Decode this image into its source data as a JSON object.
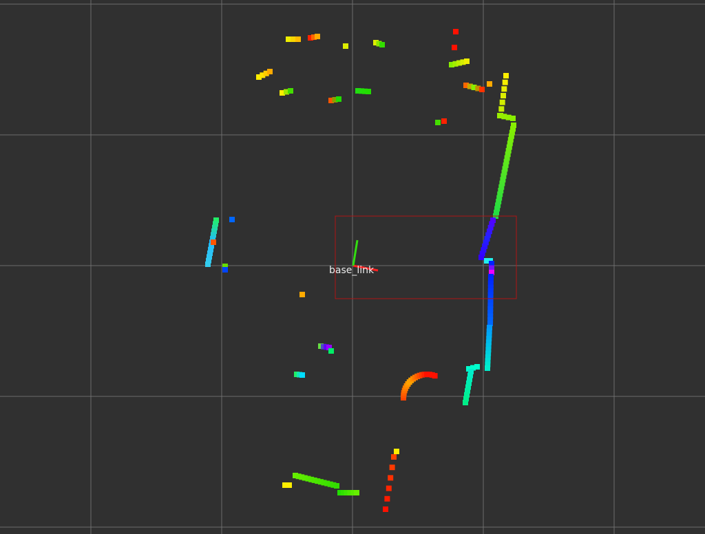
{
  "frame": {
    "label": "base_link"
  },
  "colors": {
    "background": "#303030",
    "grid": "#a0a0a0",
    "bbox": "#b01515",
    "x_axis": "#ff2020",
    "y_axis": "#33dd11"
  },
  "point_cloud": {
    "segments": [
      {
        "from": [
          419,
          57
        ],
        "to": [
          433,
          57
        ],
        "colors": [
          "#eeee00",
          "#ffbb00"
        ],
        "count": 3
      },
      {
        "from": [
          451,
          55
        ],
        "to": [
          461,
          53
        ],
        "colors": [
          "#ff2200",
          "#ffaa00"
        ],
        "count": 3
      },
      {
        "from": [
          502,
          67
        ],
        "to": [
          502,
          67
        ],
        "colors": [
          "#ddee00"
        ],
        "count": 1
      },
      {
        "from": [
          546,
          62
        ],
        "to": [
          555,
          65
        ],
        "colors": [
          "#ddee00",
          "#33dd00"
        ],
        "count": 3
      },
      {
        "from": [
          376,
          112
        ],
        "to": [
          392,
          104
        ],
        "colors": [
          "#ffee00",
          "#ffdd00",
          "#ffaa00"
        ],
        "count": 4
      },
      {
        "from": [
          410,
          135
        ],
        "to": [
          422,
          132
        ],
        "colors": [
          "#ffee00",
          "#44dd00"
        ],
        "count": 3
      },
      {
        "from": [
          481,
          146
        ],
        "to": [
          492,
          144
        ],
        "colors": [
          "#ff5500",
          "#22dd00"
        ],
        "count": 3
      },
      {
        "from": [
          520,
          132
        ],
        "to": [
          535,
          133
        ],
        "colors": [
          "#22dd11",
          "#22dd00"
        ],
        "count": 4
      },
      {
        "from": [
          662,
          46
        ],
        "to": [
          662,
          46
        ],
        "colors": [
          "#ff1100"
        ],
        "count": 1
      },
      {
        "from": [
          660,
          69
        ],
        "to": [
          660,
          69
        ],
        "colors": [
          "#ff1100"
        ],
        "count": 1
      },
      {
        "from": [
          656,
          94
        ],
        "to": [
          678,
          89
        ],
        "colors": [
          "#88ee00",
          "#eeee00"
        ],
        "count": 5
      },
      {
        "from": [
          677,
          124
        ],
        "to": [
          700,
          130
        ],
        "colors": [
          "#ff6600",
          "#88ee00",
          "#ff3300"
        ],
        "count": 5
      },
      {
        "from": [
          711,
          122
        ],
        "to": [
          711,
          122
        ],
        "colors": [
          "#ffaa00"
        ],
        "count": 1
      },
      {
        "from": [
          636,
          178
        ],
        "to": [
          645,
          176
        ],
        "colors": [
          "#44dd00",
          "#ff2200"
        ],
        "count": 2
      },
      {
        "from": [
          735,
          110
        ],
        "to": [
          727,
          168
        ],
        "colors": [
          "#ffee00",
          "#ddee00",
          "#bbee00"
        ],
        "count": 7
      },
      {
        "from": [
          726,
          168
        ],
        "to": [
          745,
          172
        ],
        "colors": [
          "#99ee00",
          "#88ee00"
        ],
        "count": 4
      },
      {
        "from": [
          746,
          182
        ],
        "to": [
          720,
          314
        ],
        "colors": [
          "#88ee00",
          "#22dd44"
        ],
        "count": 26
      },
      {
        "from": [
          716,
          320
        ],
        "to": [
          699,
          374
        ],
        "colors": [
          "#5500ff",
          "#2222ff",
          "#3300ff"
        ],
        "count": 11
      },
      {
        "from": [
          707,
          379
        ],
        "to": [
          712,
          379
        ],
        "colors": [
          "#22eeee"
        ],
        "count": 2
      },
      {
        "from": [
          714,
          383
        ],
        "to": [
          714,
          396
        ],
        "colors": [
          "#0022ff",
          "#ee00ff"
        ],
        "count": 3
      },
      {
        "from": [
          713,
          402
        ],
        "to": [
          712,
          470
        ],
        "colors": [
          "#0022ff",
          "#0066ff"
        ],
        "count": 14
      },
      {
        "from": [
          711,
          476
        ],
        "to": [
          708,
          535
        ],
        "colors": [
          "#0099ff",
          "#00eecc"
        ],
        "count": 12
      },
      {
        "from": [
          693,
          533
        ],
        "to": [
          681,
          536
        ],
        "colors": [
          "#00ffcc"
        ],
        "count": 3
      },
      {
        "from": [
          684,
          540
        ],
        "to": [
          676,
          585
        ],
        "colors": [
          "#00eecc",
          "#00ee88"
        ],
        "count": 9
      },
      {
        "from": [
          314,
          320
        ],
        "to": [
          302,
          384
        ],
        "colors": [
          "#22ee66",
          "#22bbff",
          "#33ccee"
        ],
        "count": 13
      },
      {
        "from": [
          337,
          319
        ],
        "to": [
          337,
          319
        ],
        "colors": [
          "#0066ff"
        ],
        "count": 1
      },
      {
        "from": [
          310,
          352
        ],
        "to": [
          310,
          352
        ],
        "colors": [
          "#ff5500"
        ],
        "count": 1
      },
      {
        "from": [
          327,
          387
        ],
        "to": [
          327,
          392
        ],
        "colors": [
          "#66dd00",
          "#0044ff"
        ],
        "count": 2
      },
      {
        "from": [
          439,
          428
        ],
        "to": [
          439,
          428
        ],
        "colors": [
          "#ffaa00"
        ],
        "count": 1
      },
      {
        "from": [
          466,
          503
        ],
        "to": [
          478,
          505
        ],
        "colors": [
          "#66dd44",
          "#4400ff",
          "#9900ff"
        ],
        "count": 4
      },
      {
        "from": [
          481,
          510
        ],
        "to": [
          481,
          510
        ],
        "colors": [
          "#00ee66"
        ],
        "count": 1
      },
      {
        "from": [
          431,
          544
        ],
        "to": [
          439,
          545
        ],
        "colors": [
          "#22ee66",
          "#00ddff"
        ],
        "count": 3
      },
      {
        "from": [
          429,
          691
        ],
        "to": [
          489,
          706
        ],
        "colors": [
          "#66ee00",
          "#33dd00"
        ],
        "count": 14
      },
      {
        "from": [
          414,
          705
        ],
        "to": [
          420,
          705
        ],
        "colors": [
          "#ffee00"
        ],
        "count": 2
      },
      {
        "from": [
          494,
          716
        ],
        "to": [
          518,
          716
        ],
        "colors": [
          "#22dd00",
          "#66ee00"
        ],
        "count": 6
      },
      {
        "from": [
          576,
          656
        ],
        "to": [
          576,
          656
        ],
        "colors": [
          "#ffee00"
        ],
        "count": 1
      },
      {
        "from": [
          572,
          664
        ],
        "to": [
          560,
          740
        ],
        "colors": [
          "#ff4400",
          "#ff1100"
        ],
        "count": 6
      }
    ],
    "arcs": [
      {
        "center": [
          620,
          578
        ],
        "radius": 34,
        "start_deg": 180,
        "end_deg": 270,
        "colors": [
          "#ff4400",
          "#ffaa00",
          "#ff1100"
        ],
        "count": 16
      },
      {
        "center": [
          620,
          578
        ],
        "radius": 34,
        "start_deg": 270,
        "end_deg": 290,
        "colors": [
          "#ff1100"
        ],
        "count": 4
      }
    ]
  }
}
